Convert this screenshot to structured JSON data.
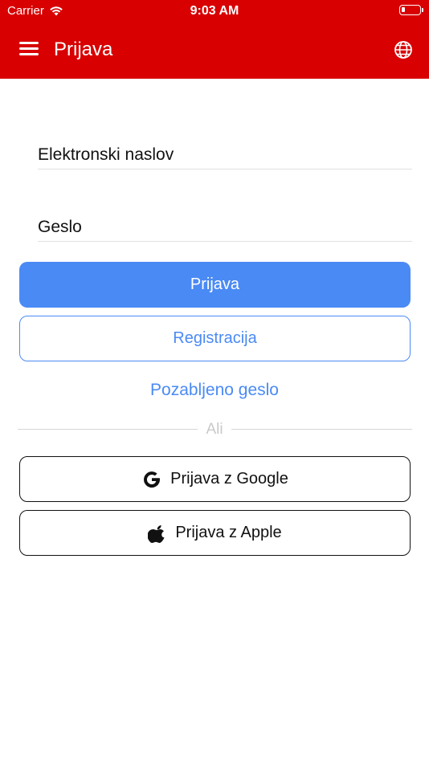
{
  "status_bar": {
    "carrier": "Carrier",
    "time": "9:03 AM"
  },
  "app_bar": {
    "title": "Prijava"
  },
  "form": {
    "email_placeholder": "Elektronski naslov",
    "password_placeholder": "Geslo"
  },
  "buttons": {
    "login": "Prijava",
    "register": "Registracija",
    "forgot_password": "Pozabljeno geslo",
    "google_login": "Prijava z Google",
    "apple_login": "Prijava z Apple"
  },
  "divider_text": "Ali",
  "colors": {
    "app_bar": "#d80000",
    "primary": "#4a8af4"
  }
}
